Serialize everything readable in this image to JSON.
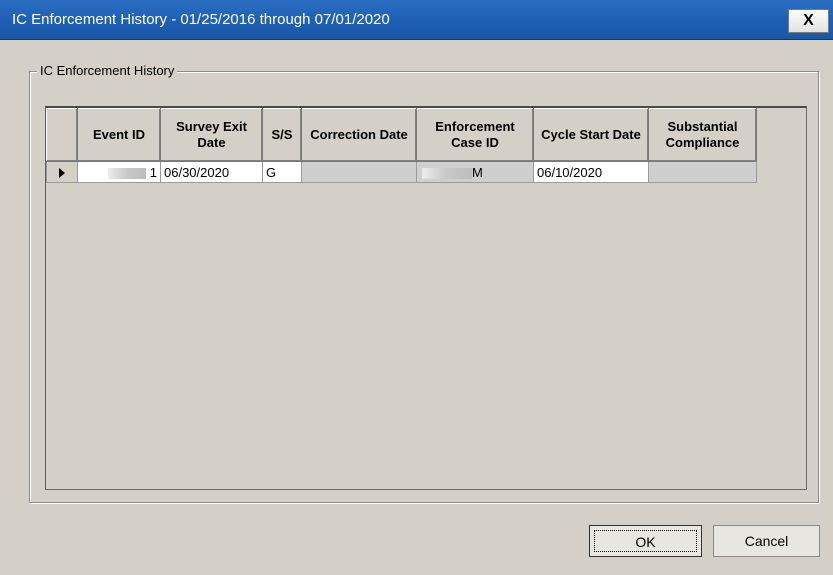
{
  "window": {
    "title": "IC Enforcement History - 01/25/2016 through 07/01/2020",
    "close_label": "X"
  },
  "group": {
    "label": "IC Enforcement History"
  },
  "grid": {
    "columns": [
      "Event ID",
      "Survey Exit Date",
      "S/S",
      "Correction Date",
      "Enforcement Case ID",
      "Cycle Start Date",
      "Substantial Compliance"
    ],
    "rows": [
      {
        "event_id": "1",
        "survey_exit_date": "06/30/2020",
        "ss": "G",
        "correction_date": "",
        "enforcement_case_id": "M",
        "cycle_start_date": "06/10/2020",
        "substantial_compliance": ""
      }
    ]
  },
  "buttons": {
    "ok": "OK",
    "cancel": "Cancel"
  }
}
